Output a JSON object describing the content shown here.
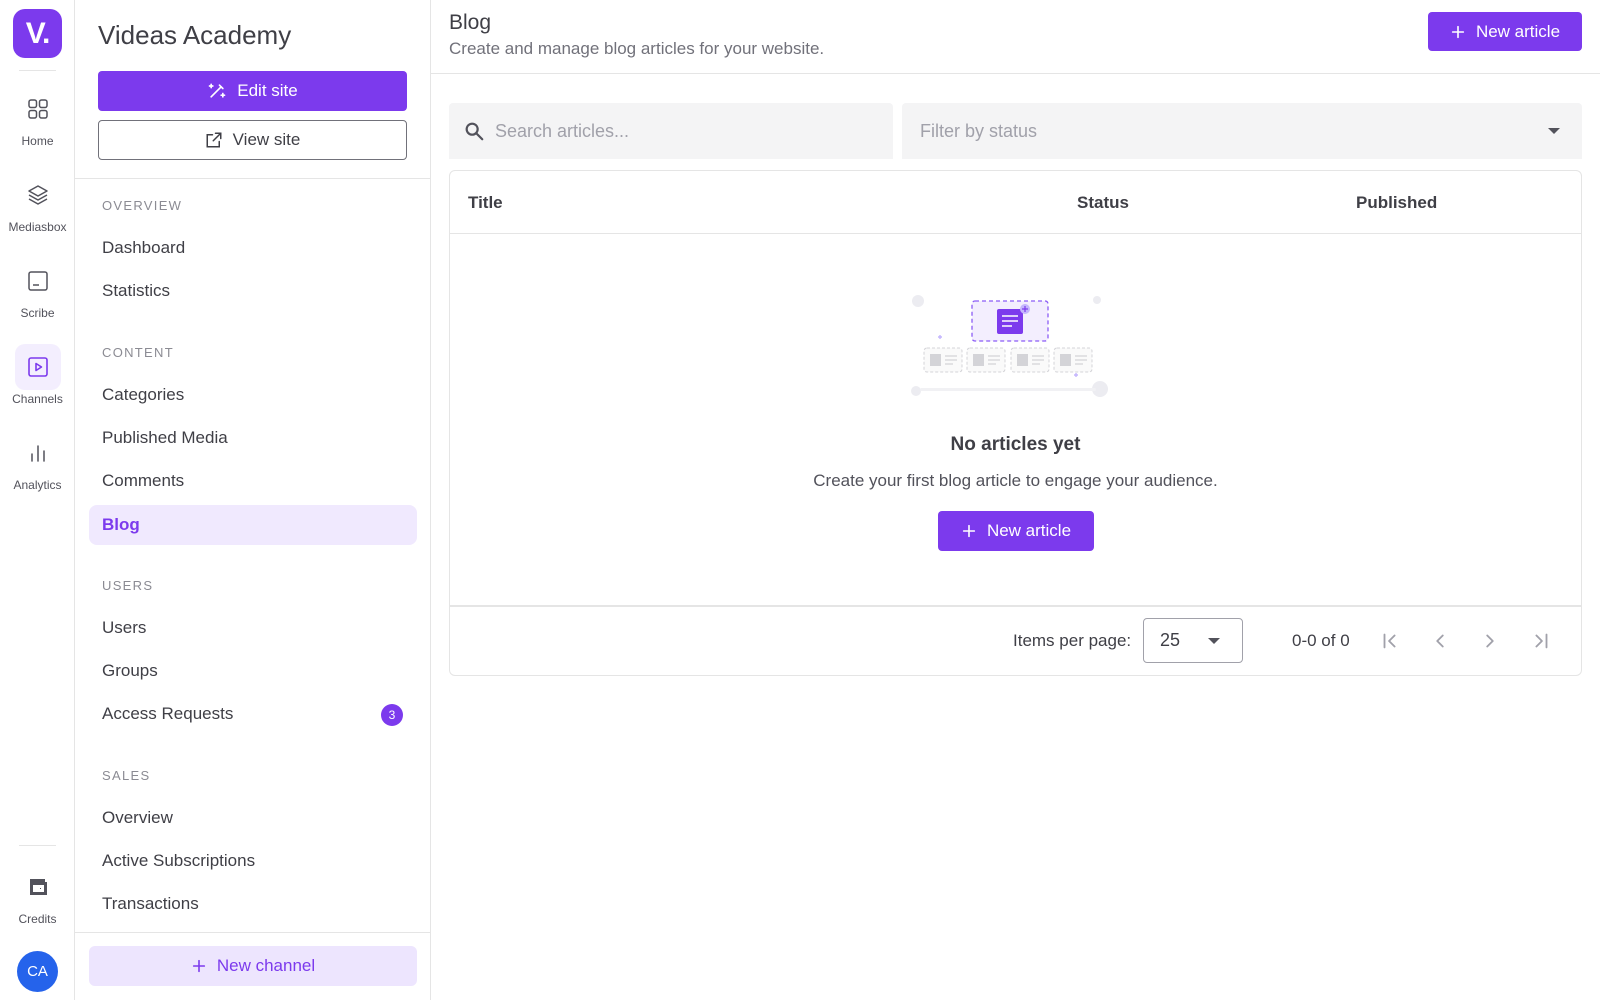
{
  "rail": {
    "logo": "V.",
    "items": [
      {
        "label": "Home",
        "icon": "grid-icon"
      },
      {
        "label": "Mediasbox",
        "icon": "layers-icon"
      },
      {
        "label": "Scribe",
        "icon": "subtitles-icon"
      },
      {
        "label": "Channels",
        "icon": "play-square-icon",
        "active": true
      },
      {
        "label": "Analytics",
        "icon": "bar-chart-icon"
      }
    ],
    "credits_label": "Credits",
    "avatar_initials": "CA"
  },
  "nav": {
    "site_title": "Videas Academy",
    "edit_site_label": "Edit site",
    "view_site_label": "View site",
    "sections": {
      "overview": {
        "heading": "OVERVIEW",
        "items": [
          "Dashboard",
          "Statistics"
        ]
      },
      "content": {
        "heading": "CONTENT",
        "items": [
          "Categories",
          "Published Media",
          "Comments",
          "Blog"
        ]
      },
      "users": {
        "heading": "USERS",
        "items": [
          "Users",
          "Groups",
          "Access Requests"
        ],
        "access_requests_badge": "3"
      },
      "sales": {
        "heading": "SALES",
        "items": [
          "Overview",
          "Active Subscriptions",
          "Transactions"
        ]
      }
    },
    "active_item": "Blog",
    "new_channel_label": "New channel"
  },
  "main": {
    "title": "Blog",
    "subtitle": "Create and manage blog articles for your website.",
    "new_article_label": "New article",
    "search": {
      "placeholder": "Search articles..."
    },
    "filter": {
      "placeholder": "Filter by status"
    },
    "table": {
      "columns": [
        "Title",
        "Status",
        "Published"
      ],
      "empty_title": "No articles yet",
      "empty_subtitle": "Create your first blog article to engage your audience.",
      "empty_button_label": "New article"
    },
    "pagination": {
      "items_per_page_label": "Items per page:",
      "items_per_page_value": "25",
      "range": "0-0 of 0"
    }
  },
  "colors": {
    "accent": "#7c3aed",
    "accent_soft": "#f0e9fe",
    "avatar": "#2563eb"
  }
}
